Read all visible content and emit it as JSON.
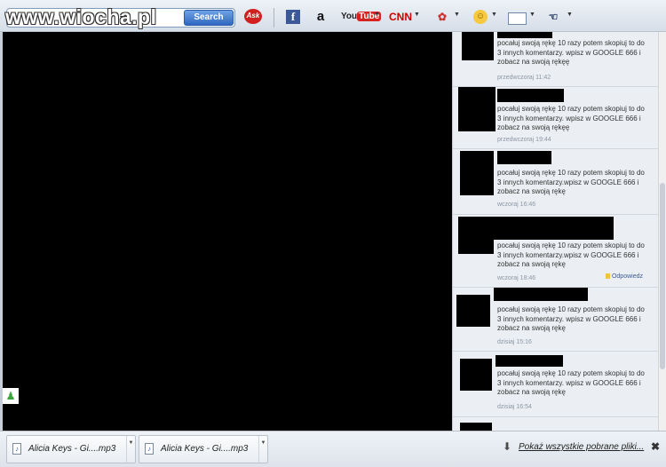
{
  "site_logo": "www.wiocha.pl",
  "toolbar": {
    "search_button": "Search",
    "ask": "Ask",
    "facebook": "f",
    "amazon": "a",
    "youtube_you": "You",
    "youtube_tube": "Tube",
    "cnn": "CNN",
    "games": "✿",
    "smiley": "☺",
    "hand": "☜",
    "icons": [
      "search-icon",
      "ask-icon",
      "facebook-icon",
      "amazon-icon",
      "youtube-icon",
      "cnn-icon",
      "games-icon",
      "smiley-icon",
      "mail-icon",
      "hand-icon"
    ]
  },
  "comments": [
    {
      "text": "pocałuj swoją rękę 10 razy potem skopiuj to do 3 innych komentarzy. wpisz w GOOGLE 666 i zobacz na swoją rękęę",
      "time": "przedwczoraj 11:42"
    },
    {
      "text": "pocałuj swoją rękę 10 razy potem skopiuj to do 3 innych komentarzy. wpisz w GOOGLE 666 i zobacz na swoją rękęę",
      "time": "przedwczoraj 19:44"
    },
    {
      "text": "pocałuj swoją rękę 10 razy potem skopiuj to do 3 innych komentarzy.wpisz w GOOGLE 666 i zobacz na swoją rękę",
      "time": "wczoraj 16:46"
    },
    {
      "text": "pocałuj swoją rękę 10 razy potem skopiuj to do 3 innych komentarzy.wpisz w GOOGLE 666 i zobacz na swoją rękę",
      "time": "wczoraj 18:46",
      "reply": "Odpowiedz"
    },
    {
      "text": "pocałuj swoją rękę 10 razy potem skopiuj to do 3 innych komentarzy. wpisz w GOOGLE 666 i zobacz na swoją rękę",
      "time": "dzisiaj 15:16"
    },
    {
      "text": "pocałuj swoją rękę 10 razy potem skopiuj to do 3 innych komentarzy. wpisz w GOOGLE 666 i zobacz na swoją rękę",
      "time": "dzisiaj 16:54"
    }
  ],
  "downloads": {
    "items": [
      {
        "name": "Alicia Keys - Gi....mp3"
      },
      {
        "name": "Alicia Keys - Gi....mp3"
      }
    ],
    "show_all": "Pokaż wszystkie pobrane pliki...",
    "close": "✖"
  },
  "colors": {
    "link": "#3b5b98",
    "timestamp": "#8c97a3",
    "panel_bg": "#ebeef3"
  }
}
